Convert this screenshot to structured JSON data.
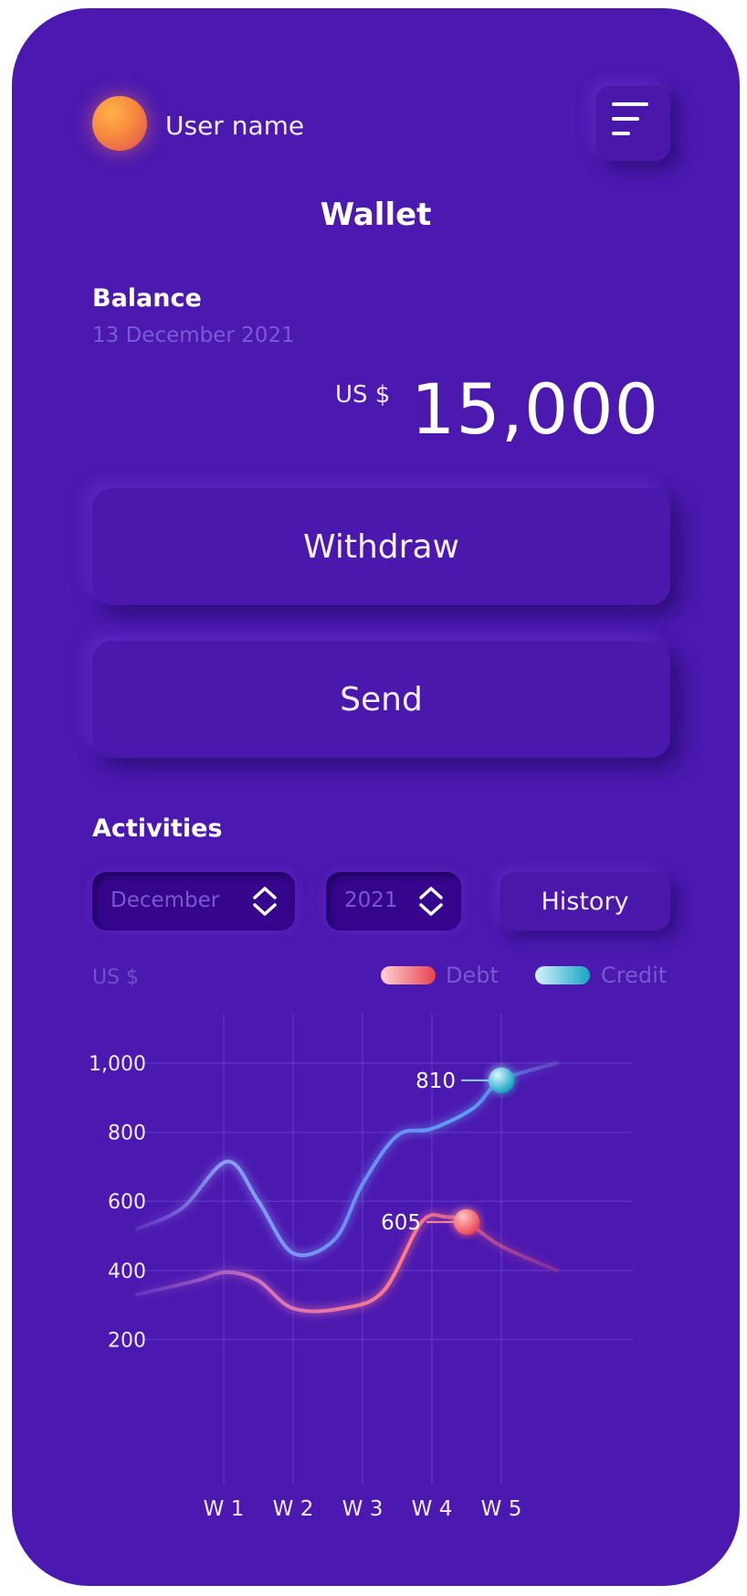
{
  "header": {
    "username": "User name",
    "menu_icon": "menu-icon",
    "title": "Wallet"
  },
  "balance": {
    "label": "Balance",
    "date": "13 December 2021",
    "currency": "US $",
    "amount": "15,000"
  },
  "actions": {
    "withdraw_label": "Withdraw",
    "send_label": "Send"
  },
  "activities": {
    "label": "Activities",
    "month_value": "December",
    "year_value": "2021",
    "history_label": "History",
    "unit_label": "US $",
    "legend": [
      {
        "name": "Debt",
        "colors": [
          "#ffd2d6",
          "#e8424f"
        ]
      },
      {
        "name": "Credit",
        "colors": [
          "#d4f3ff",
          "#16a7c0"
        ]
      }
    ]
  },
  "colors": {
    "background": "#4b18b0",
    "debt": "#e85a74",
    "credit": "#5d9cf0"
  },
  "chart_data": {
    "type": "line",
    "categories": [
      "W 1",
      "W 2",
      "W 3",
      "W 4",
      "W 5"
    ],
    "y_ticks": [
      "1,000",
      "800",
      "600",
      "400",
      "200"
    ],
    "y_tick_values": [
      1000,
      800,
      600,
      400,
      200
    ],
    "ylim": [
      0,
      1250
    ],
    "grid": true,
    "series": [
      {
        "name": "Credit",
        "x": [
          -1.25,
          -0.6,
          0.05,
          0.5,
          1.0,
          1.6,
          2.0,
          2.5,
          3.0,
          3.6,
          4.0,
          4.8
        ],
        "values": [
          520,
          580,
          715,
          600,
          450,
          490,
          650,
          790,
          810,
          870,
          950,
          1000
        ],
        "marker": {
          "x": 4.0,
          "value": 810,
          "label": "810"
        }
      },
      {
        "name": "Debt",
        "x": [
          -1.25,
          -0.4,
          0.05,
          0.5,
          1.0,
          1.7,
          2.3,
          2.85,
          3.2,
          3.5,
          4.0,
          4.8
        ],
        "values": [
          330,
          370,
          395,
          370,
          290,
          290,
          340,
          540,
          555,
          540,
          470,
          400
        ],
        "marker": {
          "x": 3.5,
          "value": 605,
          "label": "605"
        }
      }
    ]
  }
}
